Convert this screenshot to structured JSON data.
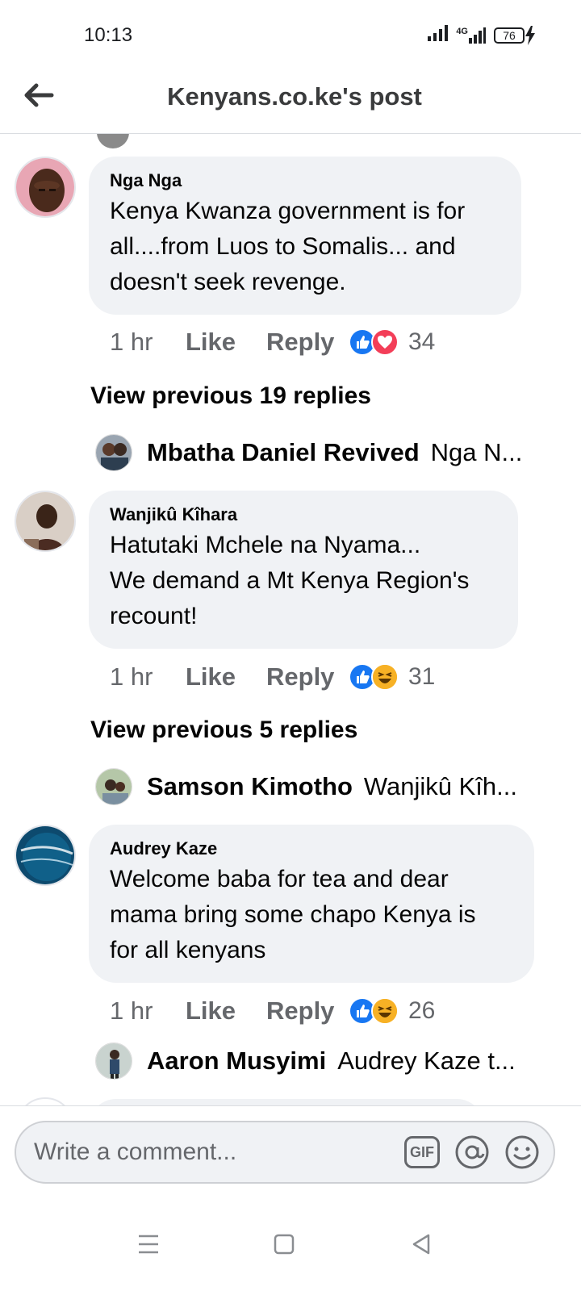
{
  "status_bar": {
    "time": "10:13",
    "network": "4G",
    "battery": "76"
  },
  "header": {
    "title": "Kenyans.co.ke's post"
  },
  "comments": [
    {
      "author": "Nga Nga",
      "text": "Kenya Kwanza government is for\nall....from Luos to Somalis... and\ndoesn't seek revenge.",
      "time": "1 hr",
      "like_label": "Like",
      "reply_label": "Reply",
      "reactions": [
        "like",
        "love"
      ],
      "reaction_count": "34",
      "view_replies": "View previous 19 replies",
      "reply_preview": {
        "name": "Mbatha Daniel Revived",
        "snippet": "Nga N..."
      }
    },
    {
      "author": "Wanjikû Kîhara",
      "text": "Hatutaki Mchele na Nyama...\nWe demand a Mt Kenya Region's\nrecount!",
      "time": "1 hr",
      "like_label": "Like",
      "reply_label": "Reply",
      "reactions": [
        "like",
        "haha"
      ],
      "reaction_count": "31",
      "view_replies": "View previous 5 replies",
      "reply_preview": {
        "name": "Samson Kimotho",
        "snippet": "Wanjikû Kîh..."
      }
    },
    {
      "author": "Audrey Kaze",
      "text": "Welcome baba for tea and dear\nmama bring some chapo Kenya is\nfor all kenyans",
      "time": "1 hr",
      "like_label": "Like",
      "reply_label": "Reply",
      "reactions": [
        "like",
        "haha"
      ],
      "reaction_count": "26",
      "reply_preview": {
        "name": "Aaron Musyimi",
        "snippet": "Audrey Kaze t..."
      }
    }
  ],
  "composer": {
    "placeholder": "Write a comment...",
    "gif_label": "GIF",
    "icons": [
      "gif-icon",
      "mention-icon",
      "emoji-icon"
    ]
  },
  "nav_bar": {
    "icons": [
      "recents-icon",
      "home-icon",
      "back-icon"
    ]
  },
  "colors": {
    "accent": "#1877f2",
    "love": "#f33e58",
    "haha": "#f7b125",
    "bubble": "#f0f2f5",
    "secondary_text": "#65676b"
  }
}
